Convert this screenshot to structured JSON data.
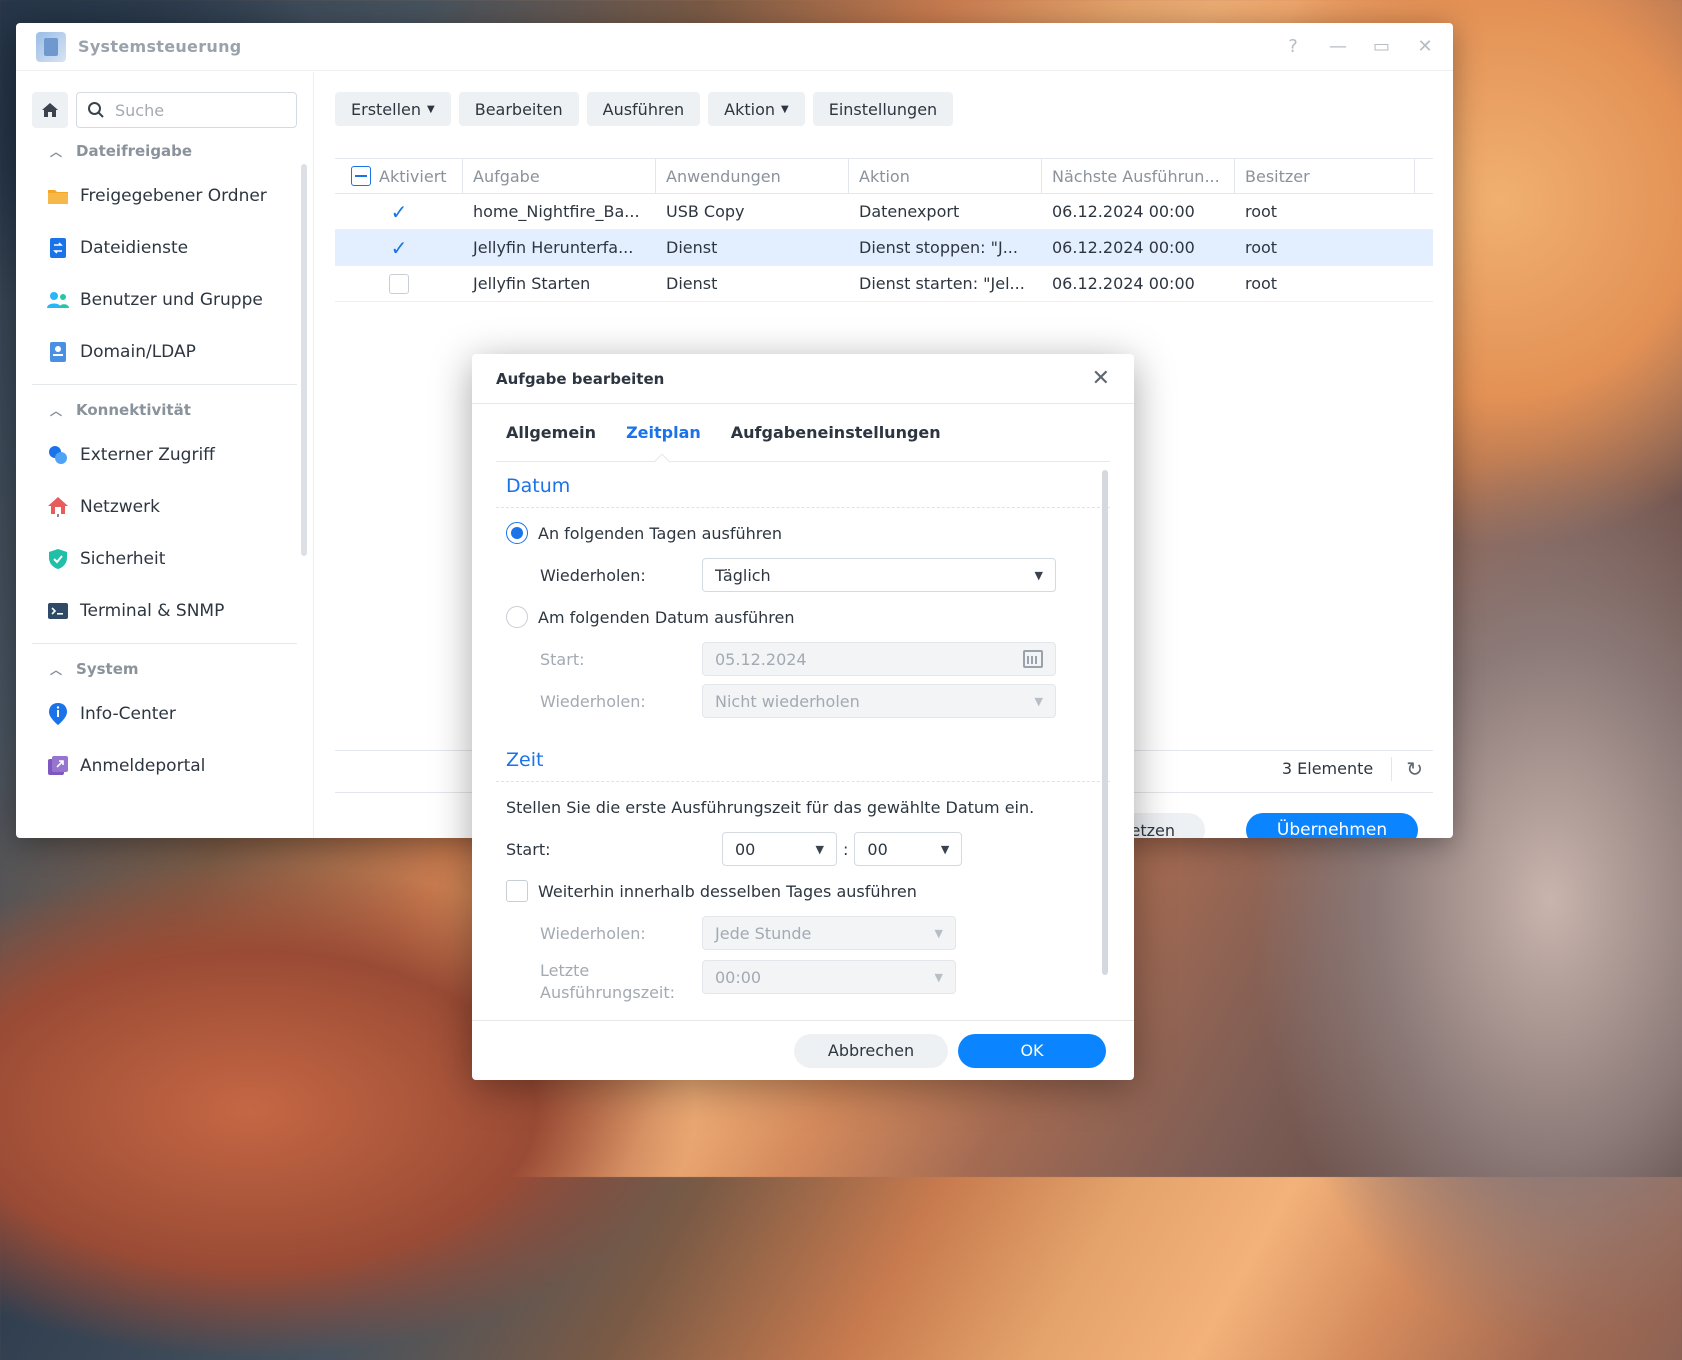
{
  "window": {
    "title": "Systemsteuerung",
    "controls": {
      "help": "?",
      "minimize": "—",
      "maximize": "▭",
      "close": "✕"
    }
  },
  "sidebar": {
    "search_placeholder": "Suche",
    "sections": [
      {
        "title": "Dateifreigabe",
        "items": [
          {
            "label": "Freigegebener Ordner",
            "icon": "folder-icon"
          },
          {
            "label": "Dateidienste",
            "icon": "file-services-icon"
          },
          {
            "label": "Benutzer und Gruppe",
            "icon": "users-icon"
          },
          {
            "label": "Domain/LDAP",
            "icon": "domain-icon"
          }
        ]
      },
      {
        "title": "Konnektivität",
        "items": [
          {
            "label": "Externer Zugriff",
            "icon": "external-access-icon"
          },
          {
            "label": "Netzwerk",
            "icon": "network-icon"
          },
          {
            "label": "Sicherheit",
            "icon": "shield-icon"
          },
          {
            "label": "Terminal & SNMP",
            "icon": "terminal-icon"
          }
        ]
      },
      {
        "title": "System",
        "items": [
          {
            "label": "Info-Center",
            "icon": "info-icon"
          },
          {
            "label": "Anmeldeportal",
            "icon": "login-portal-icon"
          }
        ]
      }
    ]
  },
  "toolbar": {
    "create": "Erstellen",
    "edit": "Bearbeiten",
    "run": "Ausführen",
    "action": "Aktion",
    "settings": "Einstellungen"
  },
  "table": {
    "columns": [
      "Aktiviert",
      "Aufgabe",
      "Anwendungen",
      "Aktion",
      "Nächste Ausführun...",
      "Besitzer"
    ],
    "rows": [
      {
        "enabled": true,
        "task": "home_Nightfire_Ba...",
        "app": "USB Copy",
        "action": "Datenexport",
        "next": "06.12.2024 00:00",
        "owner": "root",
        "selected": false
      },
      {
        "enabled": true,
        "task": "Jellyfin Herunterfa...",
        "app": "Dienst",
        "action": "Dienst stoppen: \"J...",
        "next": "06.12.2024 00:00",
        "owner": "root",
        "selected": true
      },
      {
        "enabled": false,
        "task": "Jellyfin Starten",
        "app": "Dienst",
        "action": "Dienst starten: \"Jel...",
        "next": "06.12.2024 00:00",
        "owner": "root",
        "selected": false
      }
    ],
    "count": "3 Elemente"
  },
  "main_footer": {
    "reset_partial": "setzen",
    "apply": "Übernehmen"
  },
  "dialog": {
    "title": "Aufgabe bearbeiten",
    "tabs": [
      "Allgemein",
      "Zeitplan",
      "Aufgabeneinstellungen"
    ],
    "active_tab": "Zeitplan",
    "date_section": {
      "title": "Datum",
      "option_days": "An folgenden Tagen ausführen",
      "repeat_label": "Wiederholen:",
      "repeat_value": "Täglich",
      "option_date": "Am folgenden Datum ausführen",
      "start_label": "Start:",
      "start_value": "05.12.2024",
      "repeat2_label": "Wiederholen:",
      "repeat2_value": "Nicht wiederholen"
    },
    "time_section": {
      "title": "Zeit",
      "description": "Stellen Sie die erste Ausführungszeit für das gewählte Datum ein.",
      "start_label": "Start:",
      "hour": "00",
      "minute": "00",
      "separator": ":",
      "continue_label": "Weiterhin innerhalb desselben Tages ausführen",
      "repeat_label": "Wiederholen:",
      "repeat_value": "Jede Stunde",
      "last_label": "Letzte Ausführungszeit:",
      "last_value": "00:00"
    },
    "cancel": "Abbrechen",
    "ok": "OK"
  }
}
